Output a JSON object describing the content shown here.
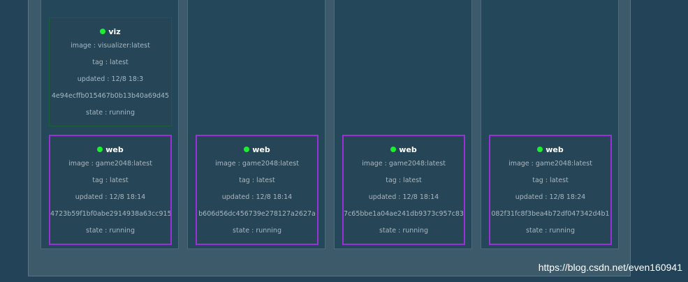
{
  "nodes": [
    {
      "containers": [
        {
          "name": "viz",
          "image": "image : visualizer:latest",
          "tag": "tag : latest",
          "updated": "updated : 12/8 18:3",
          "id": "4e94ecffb015467b0b13b40a69d45",
          "state": "state : running"
        },
        {
          "name": "web",
          "image": "image : game2048:latest",
          "tag": "tag : latest",
          "updated": "updated : 12/8 18:14",
          "id": "4723b59f1bf0abe2914938a63cc915",
          "state": "state : running"
        }
      ]
    },
    {
      "containers": [
        {
          "name": "web",
          "image": "image : game2048:latest",
          "tag": "tag : latest",
          "updated": "updated : 12/8 18:14",
          "id": "b606d56dc456739e278127a2627a",
          "state": "state : running"
        }
      ]
    },
    {
      "containers": [
        {
          "name": "web",
          "image": "image : game2048:latest",
          "tag": "tag : latest",
          "updated": "updated : 12/8 18:14",
          "id": "7c65bbe1a04ae241db9373c957c83",
          "state": "state : running"
        }
      ]
    },
    {
      "containers": [
        {
          "name": "web",
          "image": "image : game2048:latest",
          "tag": "tag : latest",
          "updated": "updated : 12/8 18:24",
          "id": "082f31fc8f3bea4b72df047342d4b1",
          "state": "state : running"
        }
      ]
    }
  ],
  "watermark": "https://blog.csdn.net/even160941",
  "colors": {
    "background": "#224358",
    "running_dot": "#1bef2f",
    "viz_border": "#19603a",
    "web_border": "#9b30d9"
  },
  "icons": {
    "status": "status-dot-icon"
  }
}
